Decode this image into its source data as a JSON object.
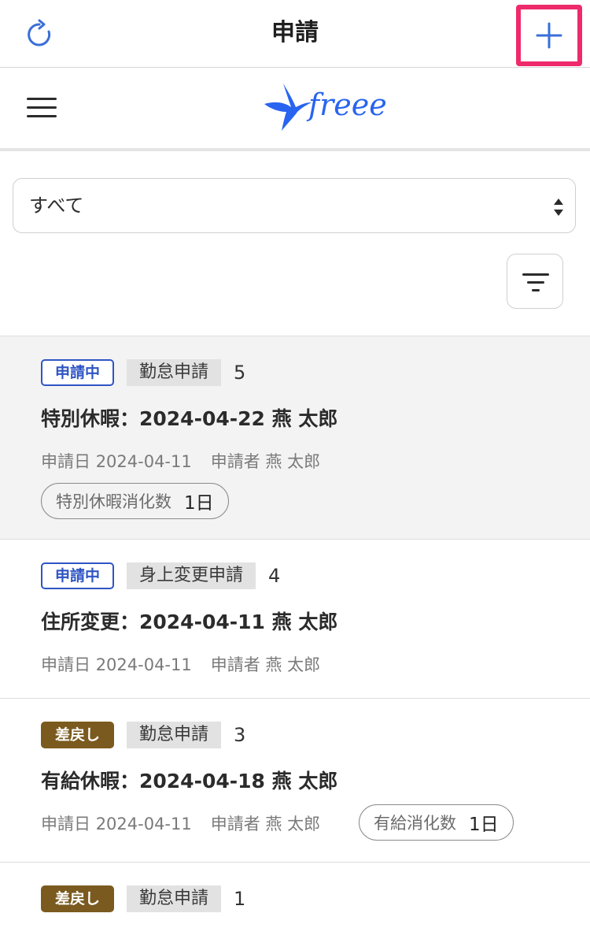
{
  "topbar": {
    "title": "申請",
    "reload_icon": "reload-icon",
    "add_icon": "plus-icon",
    "accent": "#3a6fd8",
    "highlight": "#ee2a6b"
  },
  "header": {
    "menu_icon": "hamburger-icon",
    "logo_text": "freee",
    "logo_color": "#2864f0"
  },
  "filter": {
    "selected": "すべて",
    "filter_icon": "filter-icon"
  },
  "list": [
    {
      "status": "申請中",
      "status_kind": "pending",
      "type": "勤怠申請",
      "number": "5",
      "title": "特別休暇：2024-04-22 燕 太郎",
      "date_label": "申請日",
      "date": "2024-04-11",
      "applicant_label": "申請者",
      "applicant": "燕 太郎",
      "pill_label": "特別休暇消化数",
      "pill_value": "1日"
    },
    {
      "status": "申請中",
      "status_kind": "pending",
      "type": "身上変更申請",
      "number": "4",
      "title": "住所変更：2024-04-11 燕 太郎",
      "date_label": "申請日",
      "date": "2024-04-11",
      "applicant_label": "申請者",
      "applicant": "燕 太郎"
    },
    {
      "status": "差戻し",
      "status_kind": "returned",
      "type": "勤怠申請",
      "number": "3",
      "title": "有給休暇：2024-04-18 燕 太郎",
      "date_label": "申請日",
      "date": "2024-04-11",
      "applicant_label": "申請者",
      "applicant": "燕 太郎",
      "pill_label": "有給消化数",
      "pill_value": "1日"
    },
    {
      "status": "差戻し",
      "status_kind": "returned",
      "type": "勤怠申請",
      "number": "1"
    }
  ]
}
